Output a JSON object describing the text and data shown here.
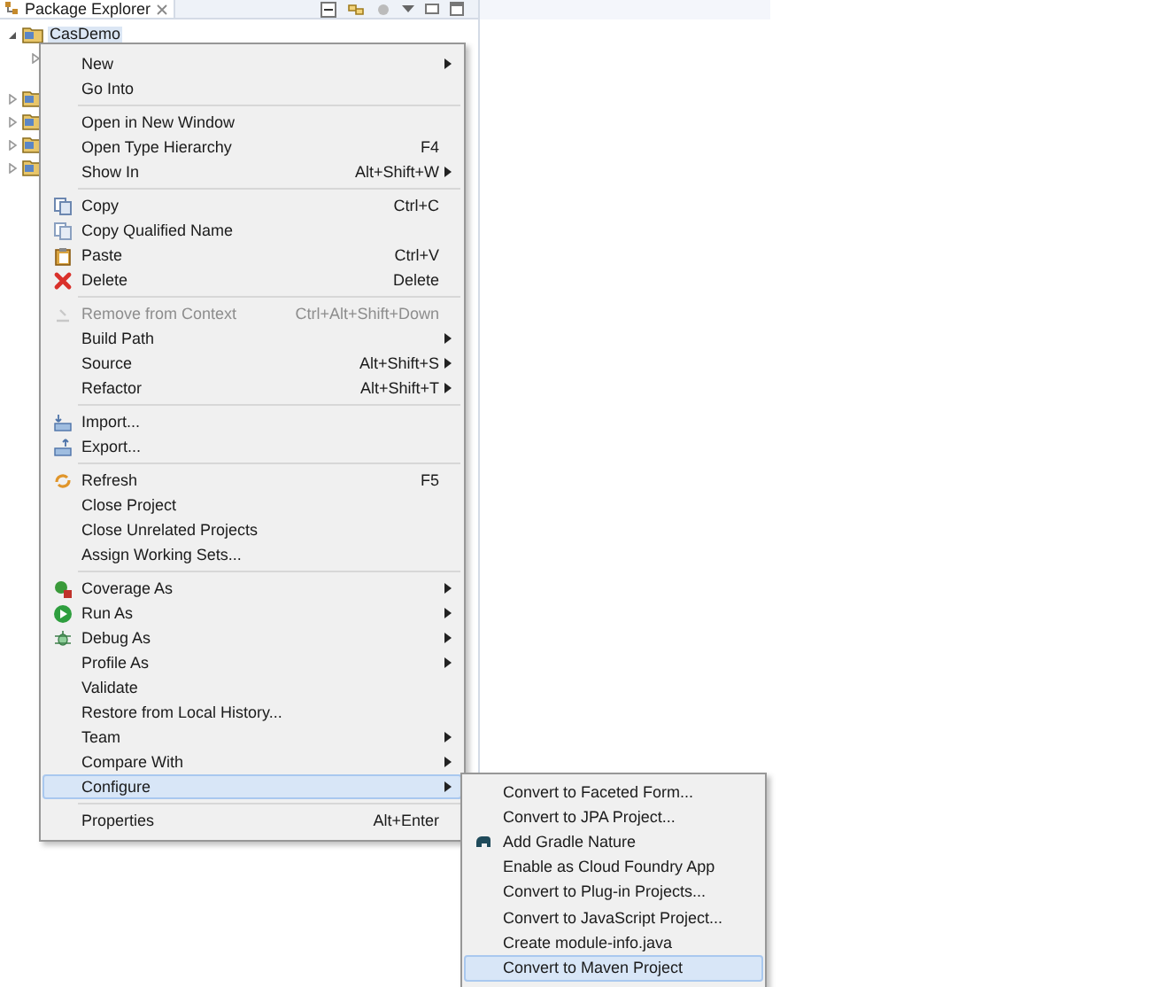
{
  "panel": {
    "title": "Package Explorer"
  },
  "tree": [
    {
      "label": "CasDemo",
      "expanded": true,
      "selected": true,
      "children": [
        {
          "expanded": false
        }
      ]
    },
    {
      "expanded": false
    },
    {
      "expanded": false
    },
    {
      "expanded": false
    },
    {
      "expanded": false
    }
  ],
  "context_menu": {
    "groups": [
      [
        {
          "label": "New",
          "submenu": true,
          "disabled": false,
          "selected": false
        },
        {
          "label": "Go Into",
          "submenu": false,
          "disabled": false,
          "selected": false
        }
      ],
      [
        {
          "label": "Open in New Window",
          "submenu": false,
          "disabled": false,
          "selected": false
        },
        {
          "label": "Open Type Hierarchy",
          "shortcut": "F4",
          "submenu": false,
          "disabled": false,
          "selected": false
        },
        {
          "label": "Show In",
          "shortcut": "Alt+Shift+W",
          "submenu": true,
          "disabled": false,
          "selected": false
        }
      ],
      [
        {
          "label": "Copy",
          "shortcut": "Ctrl+C",
          "submenu": false,
          "disabled": false,
          "selected": false
        },
        {
          "label": "Copy Qualified Name",
          "submenu": false,
          "disabled": false,
          "selected": false
        },
        {
          "label": "Paste",
          "shortcut": "Ctrl+V",
          "submenu": false,
          "disabled": false,
          "selected": false
        },
        {
          "label": "Delete",
          "shortcut": "Delete",
          "submenu": false,
          "disabled": false,
          "selected": false
        }
      ],
      [
        {
          "label": "Remove from Context",
          "shortcut": "Ctrl+Alt+Shift+Down",
          "submenu": false,
          "disabled": true,
          "selected": false
        },
        {
          "label": "Build Path",
          "submenu": true,
          "disabled": false,
          "selected": false
        },
        {
          "label": "Source",
          "shortcut": "Alt+Shift+S",
          "submenu": true,
          "disabled": false,
          "selected": false
        },
        {
          "label": "Refactor",
          "shortcut": "Alt+Shift+T",
          "submenu": true,
          "disabled": false,
          "selected": false
        }
      ],
      [
        {
          "label": "Import...",
          "submenu": false,
          "disabled": false,
          "selected": false
        },
        {
          "label": "Export...",
          "submenu": false,
          "disabled": false,
          "selected": false
        }
      ],
      [
        {
          "label": "Refresh",
          "shortcut": "F5",
          "submenu": false,
          "disabled": false,
          "selected": false
        },
        {
          "label": "Close Project",
          "submenu": false,
          "disabled": false,
          "selected": false
        },
        {
          "label": "Close Unrelated Projects",
          "submenu": false,
          "disabled": false,
          "selected": false
        },
        {
          "label": "Assign Working Sets...",
          "submenu": false,
          "disabled": false,
          "selected": false
        }
      ],
      [
        {
          "label": "Coverage As",
          "submenu": true,
          "disabled": false,
          "selected": false
        },
        {
          "label": "Run As",
          "submenu": true,
          "disabled": false,
          "selected": false
        },
        {
          "label": "Debug As",
          "submenu": true,
          "disabled": false,
          "selected": false
        },
        {
          "label": "Profile As",
          "submenu": true,
          "disabled": false,
          "selected": false
        },
        {
          "label": "Validate",
          "submenu": false,
          "disabled": false,
          "selected": false
        },
        {
          "label": "Restore from Local History...",
          "submenu": false,
          "disabled": false,
          "selected": false
        },
        {
          "label": "Team",
          "submenu": true,
          "disabled": false,
          "selected": false
        },
        {
          "label": "Compare With",
          "submenu": true,
          "disabled": false,
          "selected": false
        },
        {
          "label": "Configure",
          "submenu": true,
          "disabled": false,
          "selected": true
        }
      ],
      [
        {
          "label": "Properties",
          "shortcut": "Alt+Enter",
          "submenu": false,
          "disabled": false,
          "selected": false
        }
      ]
    ]
  },
  "submenu": {
    "items": [
      {
        "label": "Convert to Faceted Form...",
        "selected": false
      },
      {
        "label": "Convert to JPA Project...",
        "selected": false
      },
      {
        "label": "Add Gradle Nature",
        "selected": false
      },
      {
        "label": "Enable as Cloud Foundry App",
        "selected": false
      },
      {
        "label": "Convert to Plug-in Projects...",
        "selected": false
      },
      {
        "label": "Convert to JavaScript Project...",
        "selected": false
      },
      {
        "label": "Create module-info.java",
        "selected": false
      },
      {
        "label": "Convert to Maven Project",
        "selected": true
      }
    ]
  }
}
